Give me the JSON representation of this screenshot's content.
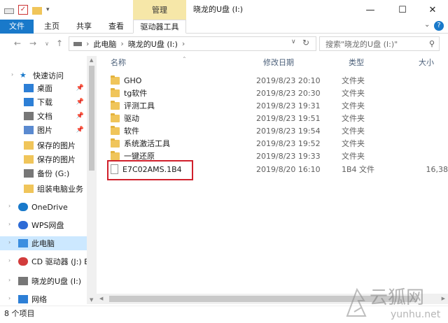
{
  "title_bar": {
    "contextual_tab": "管理",
    "window_title": "晓龙的U盘 (I:)",
    "minimize": "—",
    "maximize": "☐",
    "close": "✕"
  },
  "ribbon": {
    "tabs": [
      "文件",
      "主页",
      "共享",
      "查看",
      "驱动器工具"
    ],
    "expand_icon": "chevron-down-icon",
    "help": "?"
  },
  "address": {
    "path": [
      "此电脑",
      "晓龙的U盘 (I:)"
    ],
    "refresh_icon": "refresh-icon"
  },
  "search": {
    "placeholder": "搜索\"晓龙的U盘 (I:)\""
  },
  "nav_pane": {
    "items": [
      {
        "label": "快速访问",
        "icon": "star-icon",
        "pinned": false
      },
      {
        "label": "桌面",
        "icon": "desktop-icon",
        "pinned": true
      },
      {
        "label": "下载",
        "icon": "download-icon",
        "pinned": true
      },
      {
        "label": "文档",
        "icon": "document-icon",
        "pinned": true
      },
      {
        "label": "图片",
        "icon": "picture-icon",
        "pinned": true
      },
      {
        "label": "保存的图片",
        "icon": "folder-icon",
        "pinned": false
      },
      {
        "label": "保存的图片",
        "icon": "folder-icon",
        "pinned": false
      },
      {
        "label": "备份 (G:)",
        "icon": "drive-icon",
        "pinned": false
      },
      {
        "label": "组装电脑业务",
        "icon": "folder-icon",
        "pinned": false
      },
      {
        "label": "OneDrive",
        "icon": "cloud-icon",
        "pinned": false
      },
      {
        "label": "WPS网盘",
        "icon": "wps-cloud-icon",
        "pinned": false
      },
      {
        "label": "此电脑",
        "icon": "computer-icon",
        "pinned": false
      },
      {
        "label": "CD 驱动器 (J:) BC",
        "icon": "cd-icon",
        "pinned": false
      },
      {
        "label": "晓龙的U盘 (I:)",
        "icon": "usb-drive-icon",
        "pinned": false
      },
      {
        "label": "网络",
        "icon": "network-icon",
        "pinned": false
      }
    ]
  },
  "columns": {
    "name": "名称",
    "modified": "修改日期",
    "type": "类型",
    "size": "大小"
  },
  "files": [
    {
      "name": "GHO",
      "modified": "2019/8/23 20:10",
      "type": "文件夹",
      "size": "",
      "kind": "folder"
    },
    {
      "name": "tg软件",
      "modified": "2019/8/23 20:30",
      "type": "文件夹",
      "size": "",
      "kind": "folder"
    },
    {
      "name": "评测工具",
      "modified": "2019/8/23 19:31",
      "type": "文件夹",
      "size": "",
      "kind": "folder"
    },
    {
      "name": "驱动",
      "modified": "2019/8/23 19:51",
      "type": "文件夹",
      "size": "",
      "kind": "folder"
    },
    {
      "name": "软件",
      "modified": "2019/8/23 19:54",
      "type": "文件夹",
      "size": "",
      "kind": "folder"
    },
    {
      "name": "系统激活工具",
      "modified": "2019/8/23 19:52",
      "type": "文件夹",
      "size": "",
      "kind": "folder"
    },
    {
      "name": "一键还原",
      "modified": "2019/8/23 19:33",
      "type": "文件夹",
      "size": "",
      "kind": "folder"
    },
    {
      "name": "E7C02AMS.1B4",
      "modified": "2019/8/20 16:10",
      "type": "1B4 文件",
      "size": "16,38",
      "kind": "file"
    }
  ],
  "status": {
    "item_count": "8 个项目"
  },
  "watermark": {
    "text": "云狐网",
    "url": "yunhu.net"
  },
  "colors": {
    "accent": "#1979ca",
    "contextual": "#f6e7a8",
    "highlight_box": "#d0202c",
    "selection": "#cce8ff"
  }
}
